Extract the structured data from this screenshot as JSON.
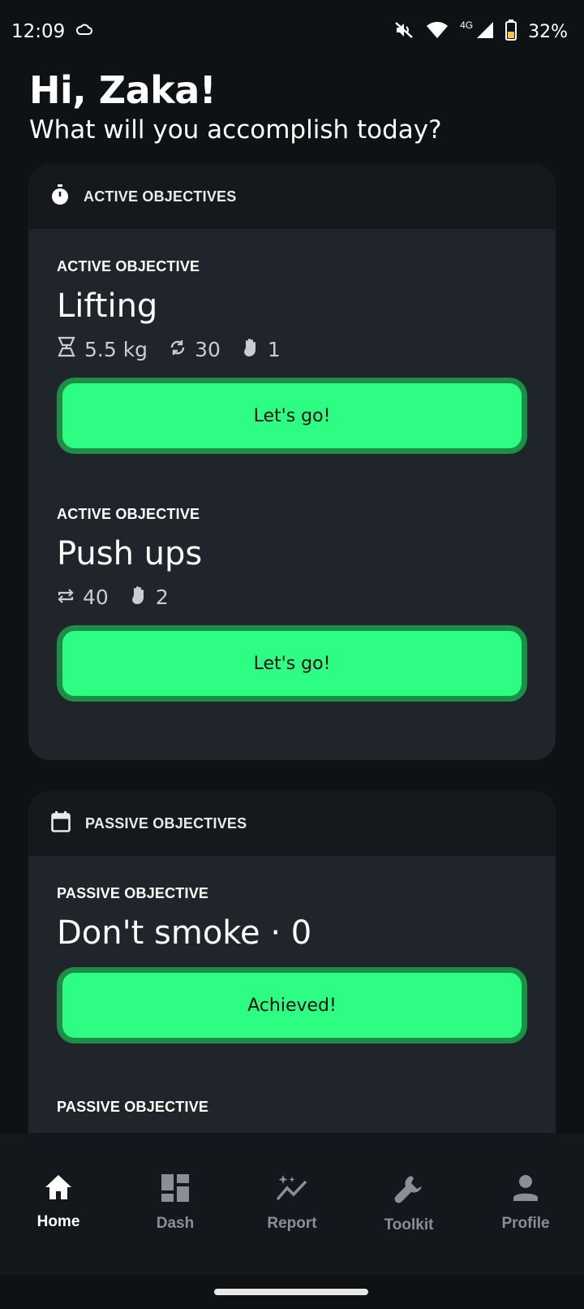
{
  "status_bar": {
    "time": "12:09",
    "network": "4G",
    "battery": "32%"
  },
  "greeting": {
    "title": "Hi, Zaka!",
    "subtitle": "What will you accomplish today?"
  },
  "active_card": {
    "header": "ACTIVE OBJECTIVES",
    "icon": "stopwatch-icon",
    "objectives": [
      {
        "kicker": "ACTIVE OBJECTIVE",
        "title": "Lifting",
        "stats": [
          {
            "icon": "weight-icon",
            "value": "5.5 kg"
          },
          {
            "icon": "sync-icon",
            "value": "30"
          },
          {
            "icon": "hand-icon",
            "value": "1"
          }
        ],
        "button": "Let's go!"
      },
      {
        "kicker": "ACTIVE OBJECTIVE",
        "title": "Push ups",
        "stats": [
          {
            "icon": "repeat-icon",
            "value": "40"
          },
          {
            "icon": "hand-icon",
            "value": "2"
          }
        ],
        "button": "Let's go!"
      }
    ]
  },
  "passive_card": {
    "header": "PASSIVE OBJECTIVES",
    "icon": "calendar-icon",
    "objectives": [
      {
        "kicker": "PASSIVE OBJECTIVE",
        "title": "Don't smoke · 0",
        "button": "Achieved!"
      },
      {
        "kicker": "PASSIVE OBJECTIVE"
      }
    ]
  },
  "nav": {
    "items": [
      {
        "label": "Home",
        "icon": "home-icon",
        "active": true
      },
      {
        "label": "Dash",
        "icon": "dashboard-icon",
        "active": false
      },
      {
        "label": "Report",
        "icon": "report-icon",
        "active": false
      },
      {
        "label": "Toolkit",
        "icon": "wrench-icon",
        "active": false
      },
      {
        "label": "Profile",
        "icon": "person-icon",
        "active": false
      }
    ]
  },
  "colors": {
    "accent": "#2dfd82",
    "accent_border": "#1c8f46",
    "card_bg": "#20252c",
    "card_header_bg": "#15191d",
    "page_bg": "#0f1215"
  }
}
